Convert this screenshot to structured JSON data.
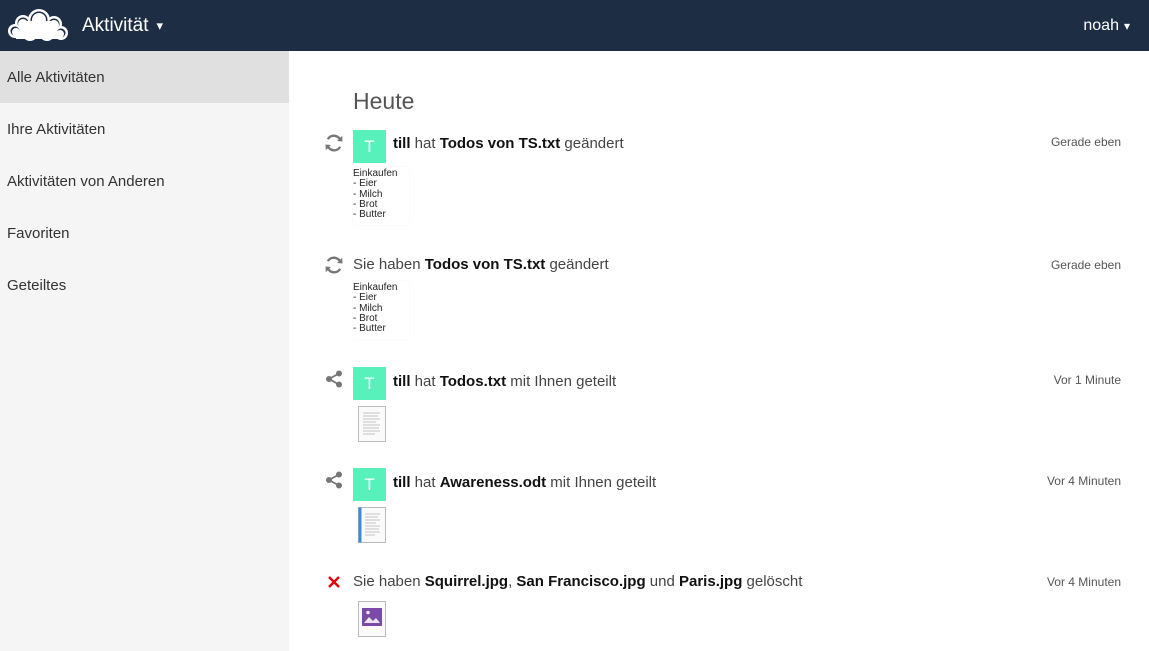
{
  "header": {
    "app_name": "Aktivität",
    "app_caret": "▾",
    "user_name": "noah",
    "user_caret": "▾",
    "bg_color": "#1d2d44"
  },
  "sidebar": {
    "items": [
      {
        "label": "Alle Aktivitäten",
        "active": true
      },
      {
        "label": "Ihre Aktivitäten",
        "active": false
      },
      {
        "label": "Aktivitäten von Anderen",
        "active": false
      },
      {
        "label": "Favoriten",
        "active": false
      },
      {
        "label": "Geteiltes",
        "active": false
      }
    ]
  },
  "main": {
    "section_title": "Heute",
    "activities": [
      {
        "type_icon": "refresh-icon",
        "avatar_letter": "T",
        "avatar_color": "#58f1bb",
        "actor": "till",
        "text1": " hat ",
        "file": "Todos von TS.txt",
        "text2": " geändert",
        "time": "Gerade eben",
        "preview": [
          "Einkaufen",
          "- Eier",
          "- Milch",
          "- Brot",
          "- Butter"
        ]
      },
      {
        "type_icon": "refresh-icon",
        "text1": "Sie haben ",
        "file": "Todos von TS.txt",
        "text2": " geändert",
        "time": "Gerade eben",
        "preview": [
          "Einkaufen",
          "- Eier",
          "- Milch",
          "- Brot",
          "- Butter"
        ]
      },
      {
        "type_icon": "share-icon",
        "avatar_letter": "T",
        "actor": "till",
        "text1": " hat ",
        "file": "Todos.txt",
        "text2": " mit Ihnen geteilt",
        "time": "Vor 1 Minute",
        "file_icon": "text-file-icon"
      },
      {
        "type_icon": "share-icon",
        "avatar_letter": "T",
        "actor": "till",
        "text1": " hat ",
        "file": "Awareness.odt",
        "text2": " mit Ihnen geteilt",
        "time": "Vor 4 Minuten",
        "file_icon": "document-file-icon"
      },
      {
        "type_icon": "delete-icon",
        "text1": "Sie haben ",
        "file": "Squirrel.jpg",
        "sep1": ", ",
        "file2": "San Francisco.jpg",
        "sep2": " und ",
        "file3": "Paris.jpg",
        "text2": " gelöscht",
        "time": "Vor 4 Minuten",
        "file_icon": "image-file-icon"
      }
    ]
  }
}
